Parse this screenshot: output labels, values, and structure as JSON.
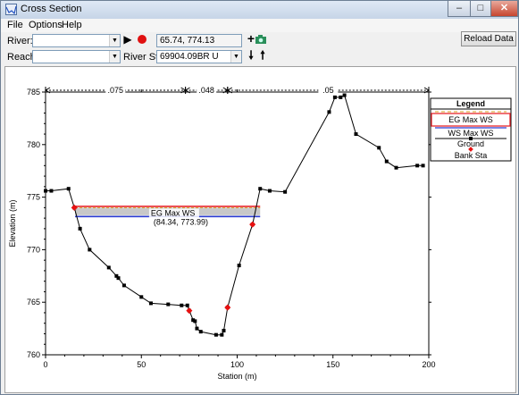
{
  "window": {
    "title": "Cross Section",
    "controls": {
      "minimize": "–",
      "maximize": "□",
      "close": "✕"
    }
  },
  "menu": {
    "items": [
      "File",
      "Options",
      "Help"
    ]
  },
  "toolbar": {
    "river_label": "River:",
    "river_value": "",
    "reach_label": "Reach:",
    "reach_value": "",
    "coord_readout": "65.74, 774.13",
    "river_sta_label": "River Sta.:",
    "river_sta_value": "69904.09BR U",
    "reload_label": "Reload Data"
  },
  "chart_data": {
    "type": "line",
    "xlabel": "Station (m)",
    "ylabel": "Elevation (m)",
    "xlim": [
      0,
      200
    ],
    "ylim": [
      760,
      785
    ],
    "xticks": [
      0,
      50,
      100,
      150,
      200
    ],
    "yticks": [
      760,
      765,
      770,
      775,
      780,
      785
    ],
    "grid": false,
    "legend": {
      "title": "Legend",
      "placement": "top-right",
      "entries": [
        "EG Max WS",
        "WS Max WS",
        "Ground",
        "Bank Sta"
      ]
    },
    "manning": [
      {
        "label": ".075",
        "from": 0,
        "to": 73
      },
      {
        "label": ".048",
        "from": 73,
        "to": 95
      },
      {
        "label": ".05",
        "from": 95,
        "to": 200
      }
    ],
    "colors": {
      "eg": "#e8262b",
      "ws": "#2a3ad0",
      "ground": "#000000",
      "bank": "#e81010",
      "fill": "#c8c8c8"
    },
    "series": [
      {
        "name": "Ground",
        "x": [
          0,
          3,
          12,
          15,
          18,
          23,
          33,
          37,
          38,
          41,
          50,
          55,
          64,
          71,
          74,
          75,
          77,
          78,
          79,
          81,
          89,
          92,
          93,
          95,
          101,
          108,
          112,
          117,
          125,
          148,
          151,
          154,
          156,
          162,
          174,
          178,
          183,
          194,
          197
        ],
        "y": [
          775.6,
          775.6,
          775.8,
          774,
          772,
          770,
          768.3,
          767.5,
          767.3,
          766.6,
          765.5,
          764.9,
          764.8,
          764.7,
          764.7,
          764.2,
          763.3,
          763.2,
          762.5,
          762.2,
          761.9,
          761.9,
          762.3,
          764.5,
          768.5,
          772.4,
          775.8,
          775.6,
          775.5,
          783.1,
          784.5,
          784.5,
          784.7,
          781,
          779.7,
          778.4,
          777.8,
          778,
          778
        ]
      },
      {
        "name": "EG Max WS",
        "y": 774.12,
        "x_from": 15.4,
        "x_to": 112
      },
      {
        "name": "WS Max WS",
        "y": 773.15,
        "x_from": 15.4,
        "x_to": 112
      }
    ],
    "bank_stations": [
      {
        "x": 15,
        "y": 774
      },
      {
        "x": 75,
        "y": 764.2
      },
      {
        "x": 95,
        "y": 764.5
      },
      {
        "x": 108,
        "y": 772.4
      }
    ],
    "tooltip": {
      "title": "EG Max WS",
      "value": "(84.34, 773.99)"
    }
  }
}
